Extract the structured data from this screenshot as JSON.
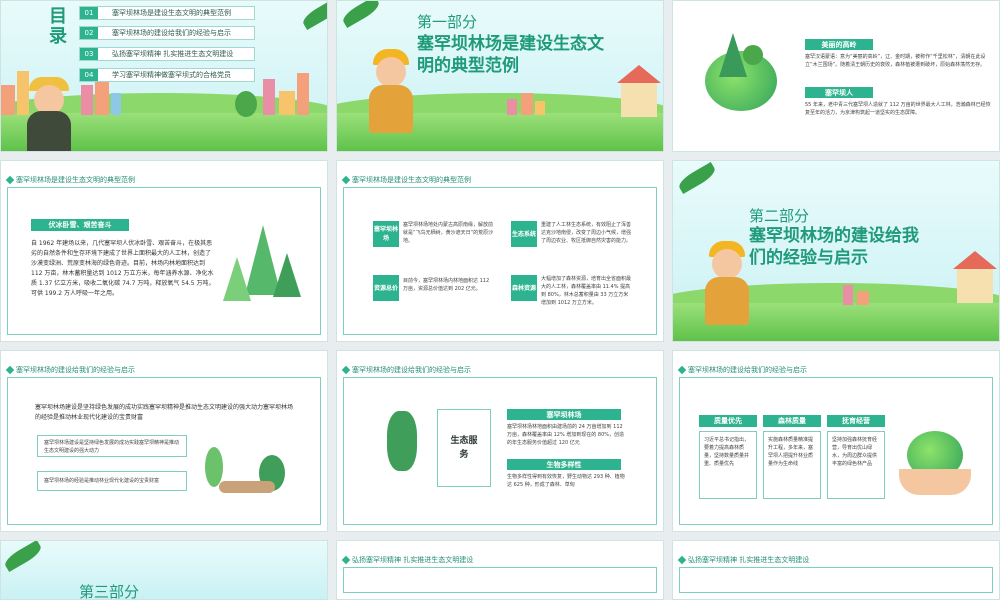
{
  "toc": {
    "title": "目录",
    "items": [
      {
        "num": "01",
        "text": "塞罕坝林场是建设生态文明的典型范例"
      },
      {
        "num": "02",
        "text": "塞罕坝林场的建设给我们的经验与启示"
      },
      {
        "num": "03",
        "text": "弘扬塞罕坝精神 扎实推进生态文明建设"
      },
      {
        "num": "04",
        "text": "学习塞罕坝精神做塞罕坝式的合格党员"
      }
    ]
  },
  "part1": {
    "label": "第一部分",
    "title": "塞罕坝林场是建设生态文明的典型范例"
  },
  "slide3": {
    "tag1": "美丽的高岭",
    "text1": "塞罕汉语蒙语：意为“美丽的高岭”，辽、金时期，被称作“千里松林”，清朝在此设立“木兰围场”。随着清王朝历史的衰败，森林植被遭到破坏，原始森林荡然无存。",
    "tag2": "塞罕坝人",
    "text2": "55 年来，老中青三代塞罕坝人造就了 112 万亩的世界最大人工林，浩瀚森林已经恢复至年的活力，为京津构筑起一道坚实的生态屏障。"
  },
  "slide4": {
    "header": "塞罕坝林场是建设生态文明的典型范例",
    "tag": "伏冰卧雪、艰苦奋斗",
    "text": "自 1962 年建场以来，几代塞罕坝人伏冰卧雪、艰苦奋斗，在极其恶劣的自然条件和生存环境下建成了世界上面积最大的人工林，创造了沙漠变绿洲、荒原变林海的绿色奇迹。目前，林场内林地面积达到 112 万亩，林木蓄积量达到 1012 万立方米，每年涵养水源、净化水质 1.37 亿立方米，吸收二氧化碳 74.7 万吨，释放氧气 54.5 万吨，可供 199.2 万人呼吸一年之用。"
  },
  "slide5": {
    "header": "塞罕坝林场是建设生态文明的典型范例",
    "b1": "塞罕坝林场",
    "t1": "塞罕坝林场地处内蒙古高原南缘，解放前就是“飞鸟无栖树，黄沙遮天日”的荒原沙地。",
    "b2": "生态系统",
    "t2": "重建了人工林生态系统，有效阻止了浑善达克沙地南侵，改变了周边小气候，增强了周边农业、牧区抵御自然灾害的能力。",
    "b3": "资源总价",
    "t3": "目前今，塞罕坝林场内林地面积达 112 万亩，资源总价值达到 202 亿元。",
    "b4": "森林资源",
    "t4": "大幅增加了森林资源，培育出全省面积最大的人工林，森林覆盖率由 11.4% 提高到 80%，林木总蓄积量由 33 万立方米增加到 1012 万立方米。"
  },
  "part2": {
    "label": "第二部分",
    "title": "塞罕坝林场的建设给我们的经验与启示"
  },
  "slide7": {
    "header": "塞罕坝林场的建设给我们的经验与启示",
    "text": "塞罕坝林场建设是坚持绿色发展的成功实践塞罕坝精神是推动生态文明建设的强大动力塞罕坝林场的经验是推动林业现代化建设的宝贵财富",
    "box1": "塞罕坝林场建设是坚持绿色发展的成功实践塞罕坝精神是推动生态文明建设的强大动力",
    "box2": "塞罕坝林场的经验是推动林业现代化建设的宝贵财富"
  },
  "slide8": {
    "header": "塞罕坝林场的建设给我们的经验与启示",
    "center": "生态服务",
    "tag1": "塞罕坝林场",
    "text1": "塞罕坝林场林地面积由建场前的 24 万亩增加到 112 万亩，森林覆盖率由 12% 增加到现在的 80%，创造的年生态服务价值超过 120 亿元",
    "tag2": "生物多样性",
    "text2": "生物多样性得到有效恢复，野生动物达 293 种、植物达 625 种，形成了森林、草甸"
  },
  "slide9": {
    "header": "塞罕坝林场的建设给我们的经验与启示",
    "col1": {
      "tag": "质量优先",
      "text": "习近平总书记指出，要着力提高森林质量，坚持数量质量并重、质量优先"
    },
    "col2": {
      "tag": "森林质量",
      "text": "实施森林质量精准提升工程，多年来，塞罕坝人把提升林业质量作为生命线"
    },
    "col3": {
      "tag": "抚育经营",
      "text": "坚持加强森林抚育经营，导育出优山绿水，为周边群众提供丰富的绿色林产品"
    }
  },
  "part3": {
    "label": "第三部分"
  },
  "slide11": {
    "header": "弘扬塞罕坝精神 扎实推进生态文明建设"
  },
  "slide12": {
    "header": "弘扬塞罕坝精神 扎实推进生态文明建设"
  },
  "colors": {
    "accent": "#2db38f",
    "title": "#1f9a7a"
  }
}
